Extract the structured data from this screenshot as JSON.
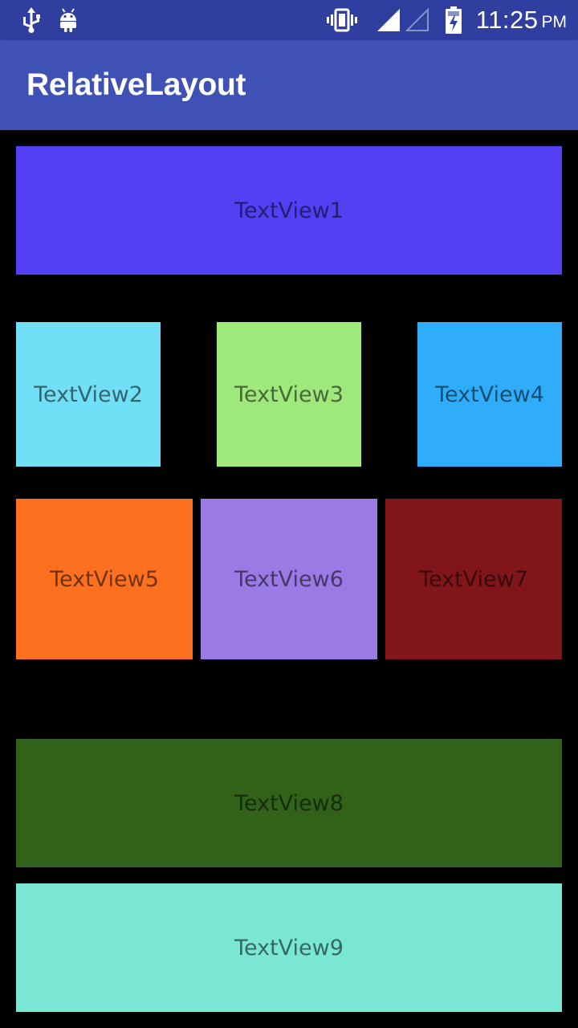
{
  "status_bar": {
    "time": "11:25",
    "ampm": "PM",
    "background": "#303f9f",
    "icons": [
      "usb-icon",
      "android-icon",
      "vibrate-icon",
      "signal-full-icon",
      "signal-empty-icon",
      "battery-charging-icon"
    ]
  },
  "app_bar": {
    "title": "RelativeLayout",
    "background": "#3f51b5"
  },
  "text_views": [
    {
      "label": "TextView1",
      "color": "#5340f5"
    },
    {
      "label": "TextView2",
      "color": "#71e0f7"
    },
    {
      "label": "TextView3",
      "color": "#9fe87b"
    },
    {
      "label": "TextView4",
      "color": "#30adfa"
    },
    {
      "label": "TextView5",
      "color": "#fd7020"
    },
    {
      "label": "TextView6",
      "color": "#9a7be5"
    },
    {
      "label": "TextView7",
      "color": "#81161a"
    },
    {
      "label": "TextView8",
      "color": "#316219"
    },
    {
      "label": "TextView9",
      "color": "#7ae7d5"
    }
  ],
  "background": "#000000"
}
